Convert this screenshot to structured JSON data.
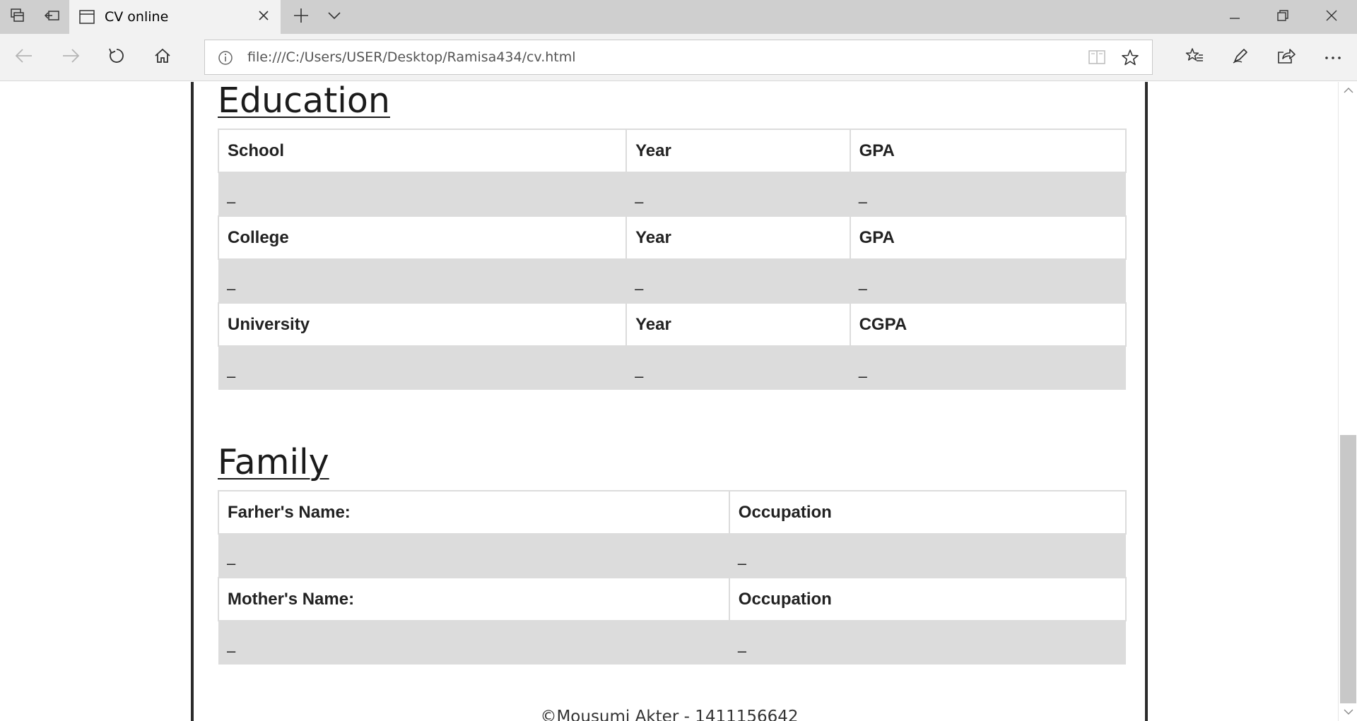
{
  "browser": {
    "tab": {
      "title": "CV online"
    },
    "address": {
      "url": "file:///C:/Users/USER/Desktop/Ramisa434/cv.html"
    }
  },
  "page": {
    "education": {
      "heading": "Education",
      "rows": [
        {
          "headers": [
            "School",
            "Year",
            "GPA"
          ],
          "values": [
            "–",
            "–",
            "–"
          ]
        },
        {
          "headers": [
            "College",
            "Year",
            "GPA"
          ],
          "values": [
            "–",
            "–",
            "–"
          ]
        },
        {
          "headers": [
            "University",
            "Year",
            "CGPA"
          ],
          "values": [
            "–",
            "–",
            "–"
          ]
        }
      ]
    },
    "family": {
      "heading": "Family",
      "rows": [
        {
          "headers": [
            "Farher's Name:",
            "Occupation"
          ],
          "values": [
            "–",
            "–"
          ]
        },
        {
          "headers": [
            "Mother's Name:",
            "Occupation"
          ],
          "values": [
            "–",
            "–"
          ]
        }
      ]
    },
    "footer": "©Mousumi Akter - 1411156642"
  },
  "icons": {
    "tab_actions": "tabs-aside-icon",
    "tab_restore": "restore-tabs-icon",
    "tab_page": "page-icon",
    "tab_close": "close-icon",
    "new_tab": "plus-icon",
    "tab_list": "chevron-down-icon",
    "minimize": "minimize-icon",
    "maximize": "restore-window-icon",
    "close_window": "close-icon",
    "back": "back-arrow-icon",
    "forward": "forward-arrow-icon",
    "refresh": "refresh-icon",
    "home": "home-icon",
    "info": "info-icon",
    "reading_view": "book-icon",
    "favorite": "star-icon",
    "favorites_hub": "favorites-list-icon",
    "notes": "pen-icon",
    "share": "share-icon",
    "more": "more-icon"
  }
}
